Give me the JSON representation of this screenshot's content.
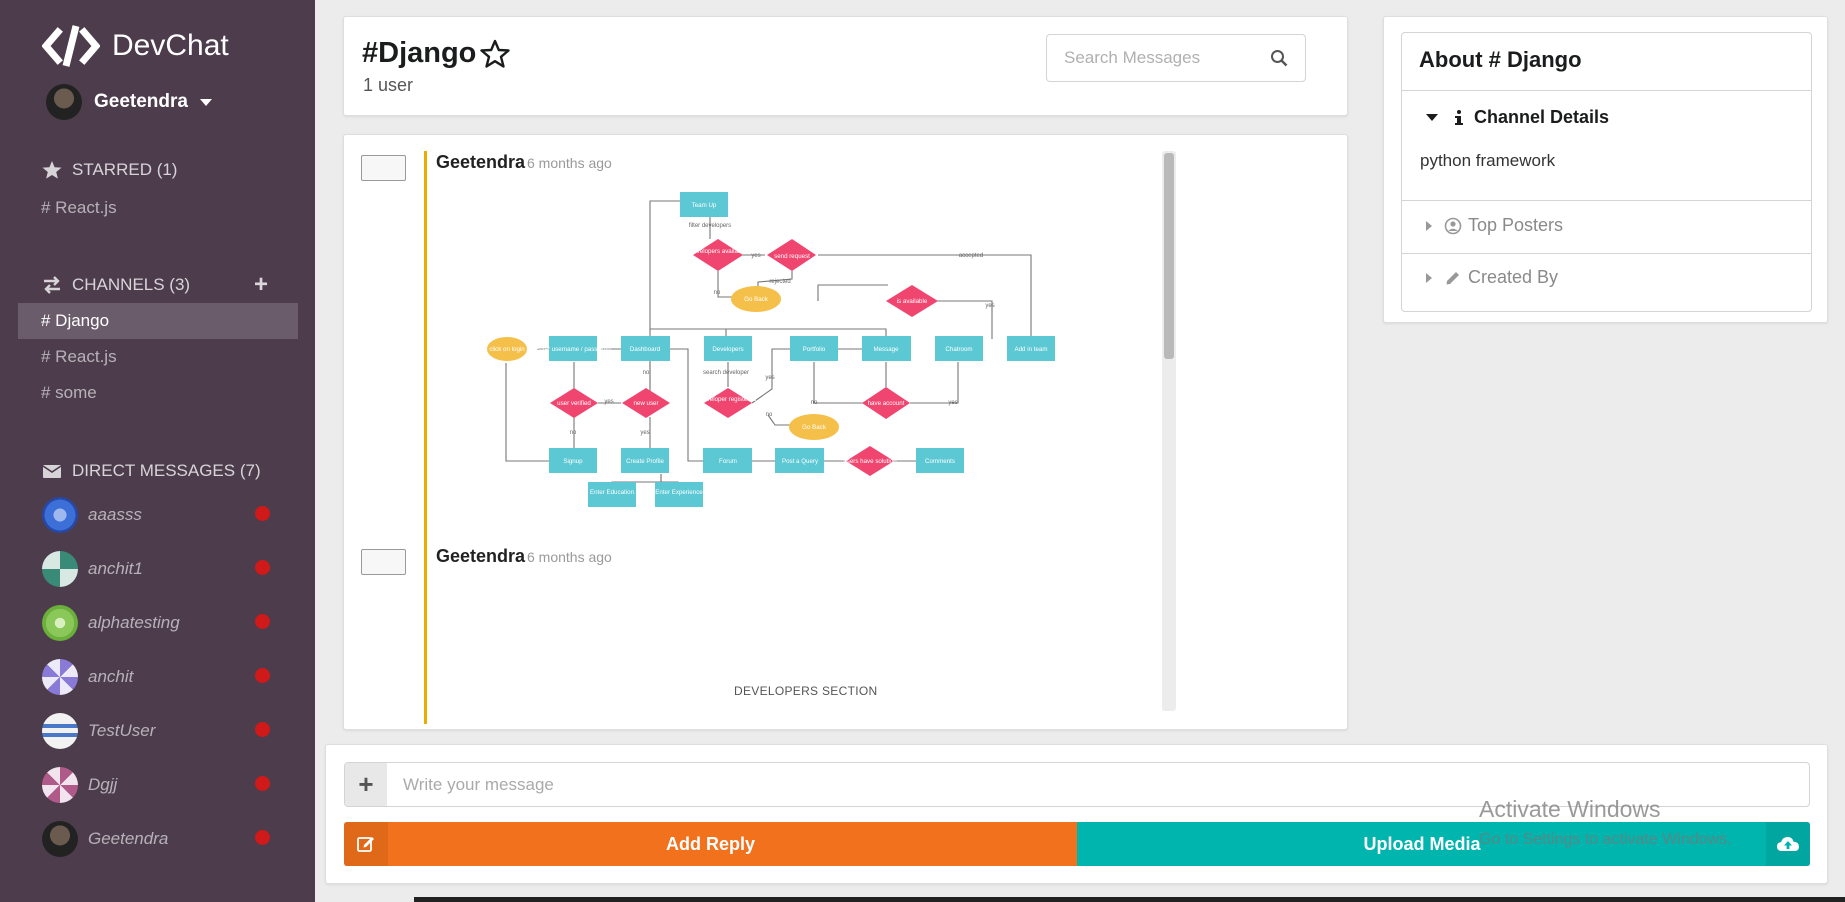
{
  "app": {
    "name": "DevChat"
  },
  "user": {
    "name": "Geetendra"
  },
  "sidebar": {
    "starred": {
      "heading": "STARRED (1)",
      "items": [
        "# React.js"
      ]
    },
    "channels": {
      "heading": "CHANNELS (3)",
      "add_label": "+",
      "items": [
        "# Django",
        "# React.js",
        "# some"
      ],
      "active": "# Django"
    },
    "direct_messages": {
      "heading": "DIRECT MESSAGES (7)",
      "items": [
        {
          "name": "aaasss",
          "status": "offline"
        },
        {
          "name": "anchit1",
          "status": "offline"
        },
        {
          "name": "alphatesting",
          "status": "offline"
        },
        {
          "name": "anchit",
          "status": "offline"
        },
        {
          "name": "TestUser",
          "status": "offline"
        },
        {
          "name": "Dgjj",
          "status": "offline"
        },
        {
          "name": "Geetendra",
          "status": "offline"
        }
      ]
    }
  },
  "header": {
    "title": "#Django",
    "user_count": "1 user",
    "search_placeholder": "Search Messages"
  },
  "messages": [
    {
      "author": "Geetendra",
      "time": "6 months ago",
      "type": "image"
    },
    {
      "author": "Geetendra",
      "time": "6 months ago",
      "type": "image",
      "caption": "DEVELOPERS SECTION"
    }
  ],
  "flowchart": {
    "nodes": [
      "Team Up",
      "filter developers",
      "developers availabel",
      "yes",
      "send request",
      "accepted",
      "rejected",
      "no",
      "Go Back",
      "is available",
      "yes",
      "click on login",
      "Enter username / password",
      "Dashboard",
      "Developers",
      "Portfolio",
      "Message",
      "Chatroom",
      "Add in team",
      "user verified",
      "yes",
      "new user",
      "no",
      "search developer",
      "yes",
      "developer registered",
      "no",
      "have account",
      "yes",
      "no",
      "no",
      "Go Back",
      "yes",
      "Signup",
      "Create Profile",
      "Forum",
      "Post a Query",
      "users have solution",
      "Comments",
      "Enter Education",
      "Enter Experience"
    ]
  },
  "about": {
    "title": "About # Django",
    "sections": [
      {
        "label": "Channel Details",
        "open": true,
        "content": "python framework"
      },
      {
        "label": "Top Posters",
        "open": false
      },
      {
        "label": "Created By",
        "open": false
      }
    ]
  },
  "composer": {
    "placeholder": "Write your message",
    "reply_label": "Add Reply",
    "upload_label": "Upload Media"
  },
  "watermark": {
    "line1": "Activate Windows",
    "line2": "Go to Settings to activate Windows."
  },
  "colors": {
    "sidebar": "#4c3c4c",
    "reply": "#f2711c",
    "upload": "#00b5ad",
    "message_bar": "#eaae00",
    "status_offline": "#d01919",
    "flow_box": "#5bc8d3",
    "flow_diamond": "#f0456f",
    "flow_oval": "#f5c04a"
  }
}
